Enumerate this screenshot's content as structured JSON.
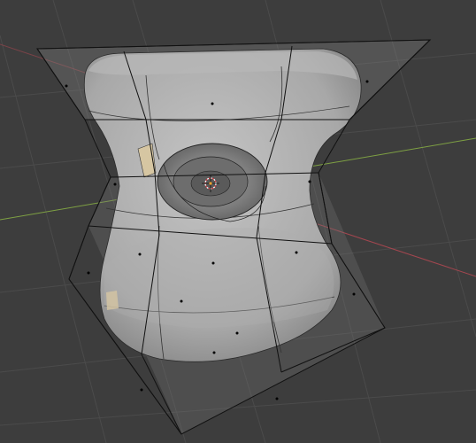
{
  "viewport": {
    "background": "#3d3d3d",
    "grid_color": "#4a4a4a",
    "x_axis_color": "#a3464f",
    "y_axis_color": "#7ea043",
    "mesh_fill": "#a9a9a9",
    "mesh_shade": "#8a8a8a",
    "cage_color": "#1a1a1a",
    "cage_fill": "rgba(150,150,150,0.35)",
    "origin_icon": "3d-cursor-icon"
  }
}
